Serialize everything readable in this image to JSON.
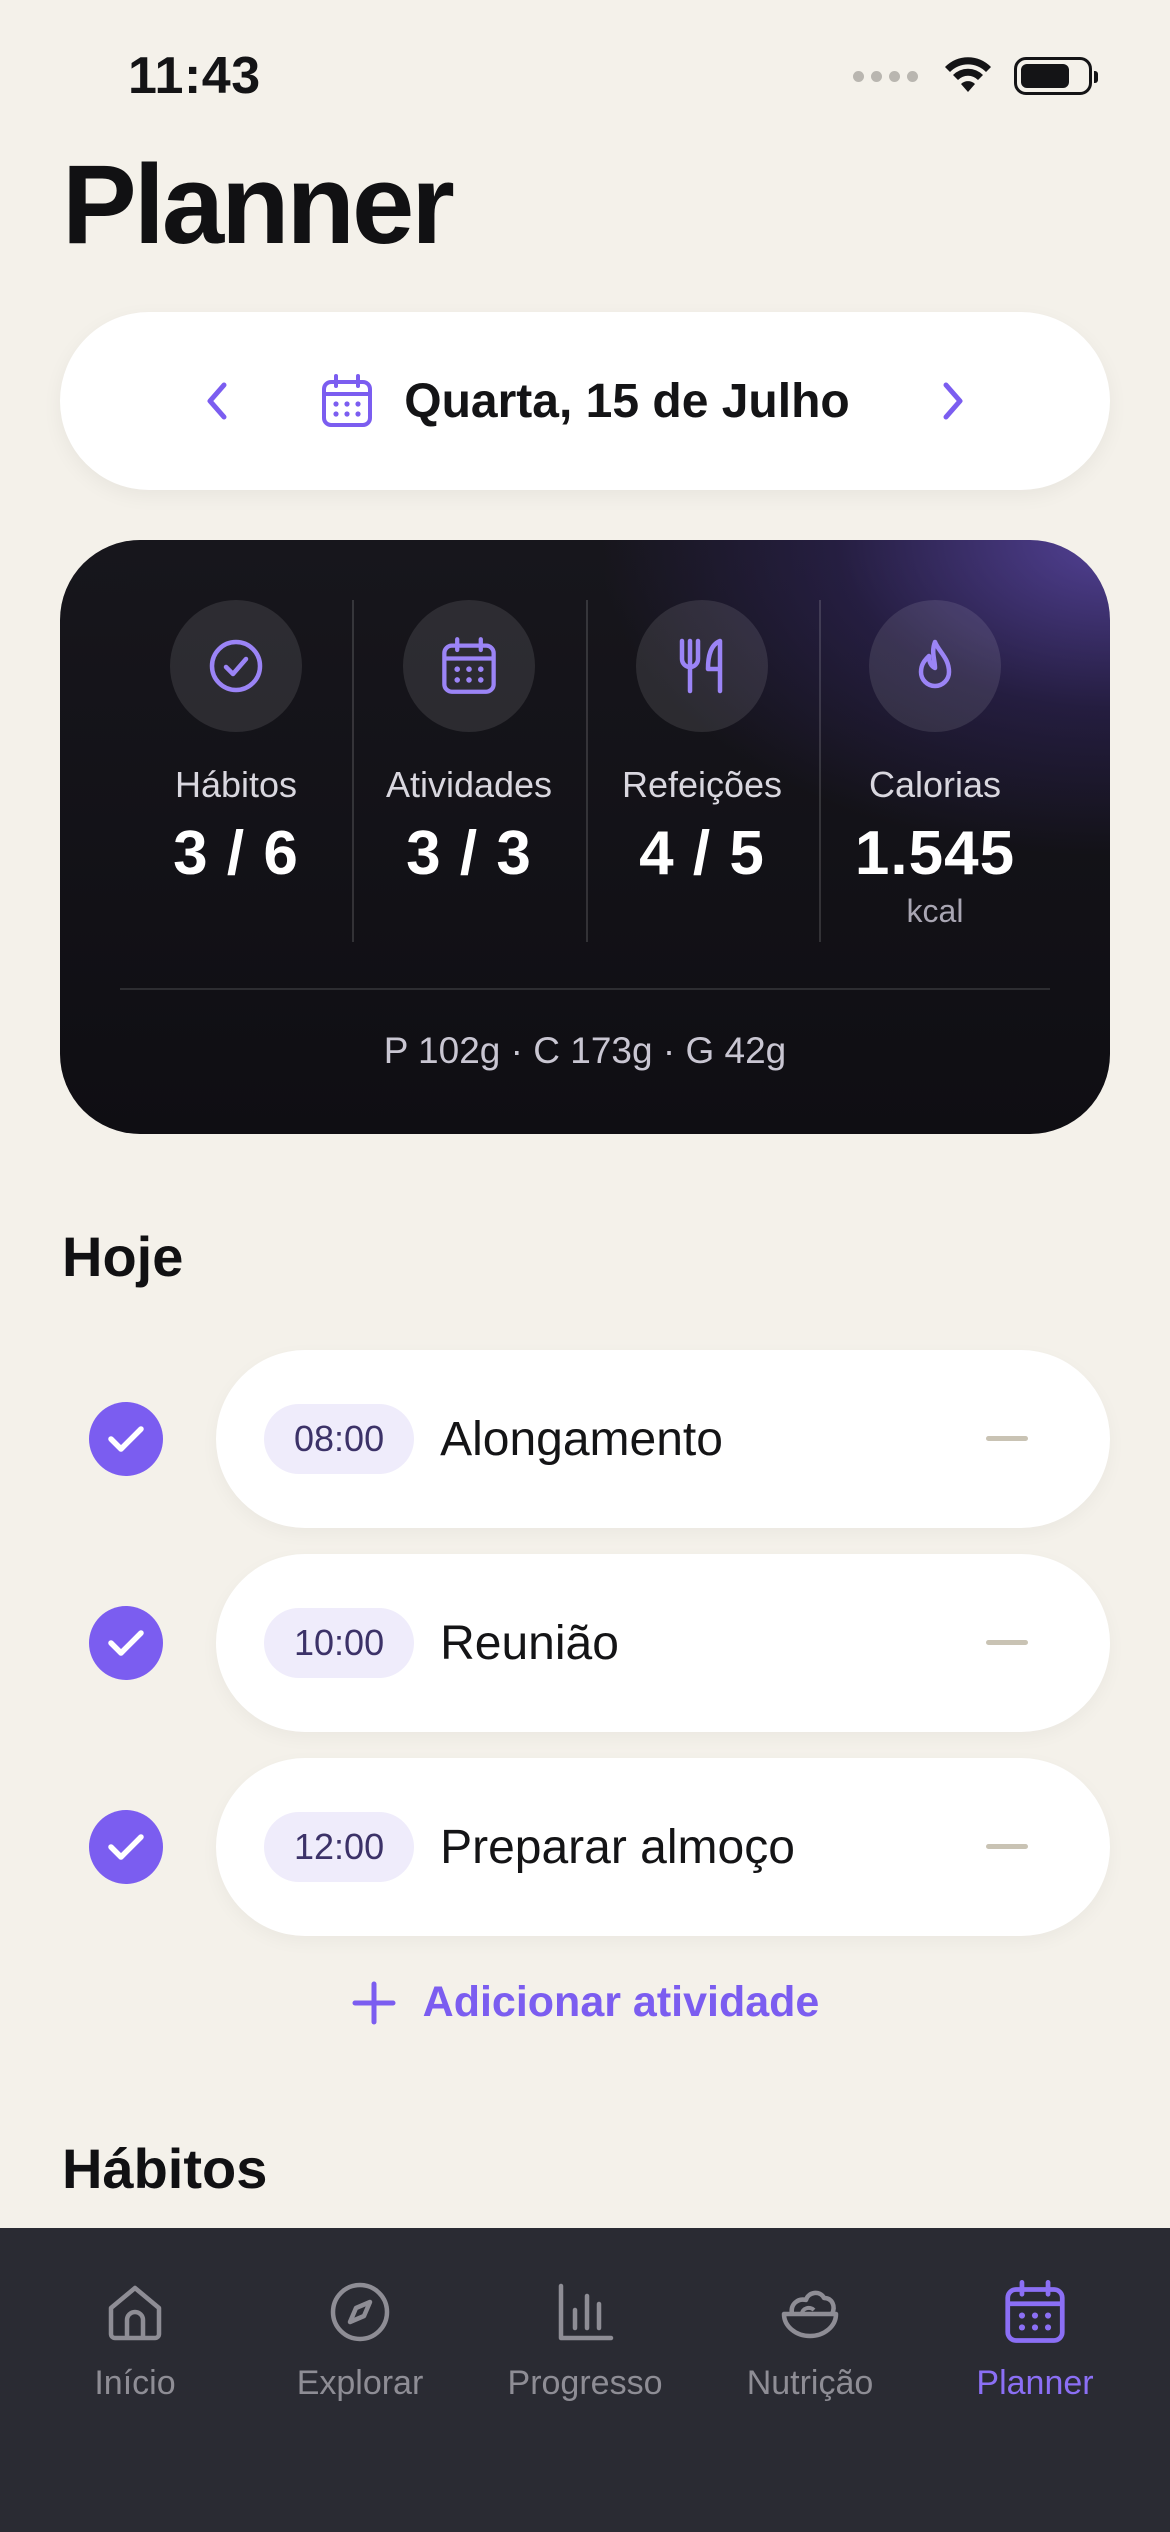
{
  "status_bar": {
    "time": "11:43"
  },
  "header": {
    "title": "Planner"
  },
  "date_selector": {
    "label": "Quarta, 15 de Julho"
  },
  "summary": {
    "stats": [
      {
        "label": "Hábitos",
        "value": "3 / 6",
        "icon": "check-circle-icon"
      },
      {
        "label": "Atividades",
        "value": "3 / 3",
        "icon": "calendar-icon"
      },
      {
        "label": "Refeições",
        "value": "4 / 5",
        "icon": "fork-knife-icon"
      },
      {
        "label": "Calorias",
        "value": "1.545",
        "unit": "kcal",
        "icon": "flame-icon"
      }
    ],
    "macros": "P 102g · C 173g · G 42g"
  },
  "today": {
    "title": "Hoje",
    "activities": [
      {
        "time": "08:00",
        "name": "Alongamento",
        "done": true
      },
      {
        "time": "10:00",
        "name": "Reunião",
        "done": true
      },
      {
        "time": "12:00",
        "name": "Preparar almoço",
        "done": true
      }
    ],
    "add_label": "Adicionar atividade"
  },
  "habits": {
    "title": "Hábitos"
  },
  "tab_bar": {
    "items": [
      {
        "label": "Início",
        "icon": "home-icon"
      },
      {
        "label": "Explorar",
        "icon": "compass-icon"
      },
      {
        "label": "Progresso",
        "icon": "bar-chart-icon"
      },
      {
        "label": "Nutrição",
        "icon": "salad-bowl-icon"
      },
      {
        "label": "Planner",
        "icon": "calendar-icon",
        "active": true
      }
    ]
  },
  "colors": {
    "accent": "#7b5df0",
    "background": "#f4f1ea",
    "card_dark": "#121117",
    "tab_bar": "#2a2b33"
  }
}
